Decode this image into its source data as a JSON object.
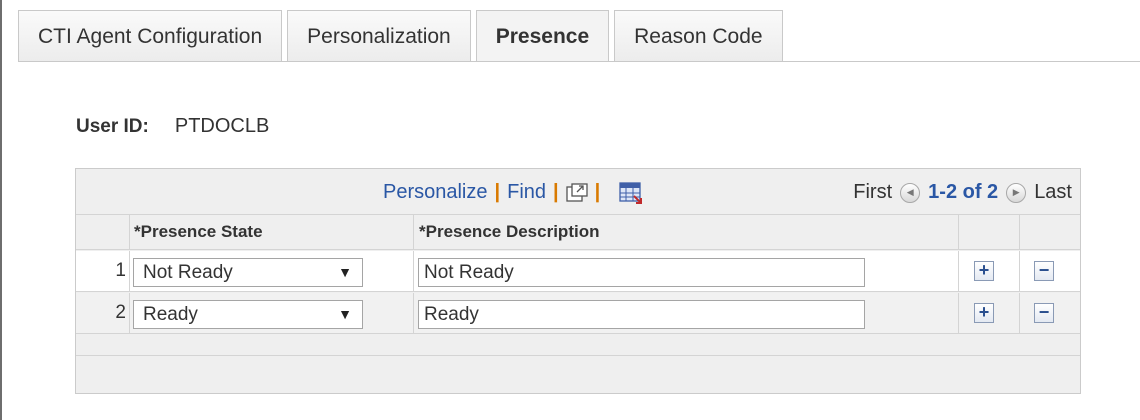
{
  "tabs": [
    {
      "label": "CTI Agent Configuration"
    },
    {
      "label": "Personalization"
    },
    {
      "label": "Presence"
    },
    {
      "label": "Reason Code"
    }
  ],
  "user": {
    "label": "User ID:",
    "value": "PTDOCLB"
  },
  "grid": {
    "nav": {
      "personalize": "Personalize",
      "find": "Find",
      "sep": "|",
      "first": "First",
      "range": "1-2 of 2",
      "last": "Last"
    },
    "columns": {
      "state": "*Presence State",
      "description": "*Presence Description"
    },
    "rows": [
      {
        "num": "1",
        "state": "Not Ready",
        "description": "Not Ready"
      },
      {
        "num": "2",
        "state": "Ready",
        "description": "Ready"
      }
    ],
    "icons": {
      "add": "+",
      "delete": "−",
      "prev": "◀",
      "next": "▶",
      "dropdown": "▼"
    }
  },
  "colors": {
    "link": "#2a57a5",
    "separator": "#d97a00"
  }
}
